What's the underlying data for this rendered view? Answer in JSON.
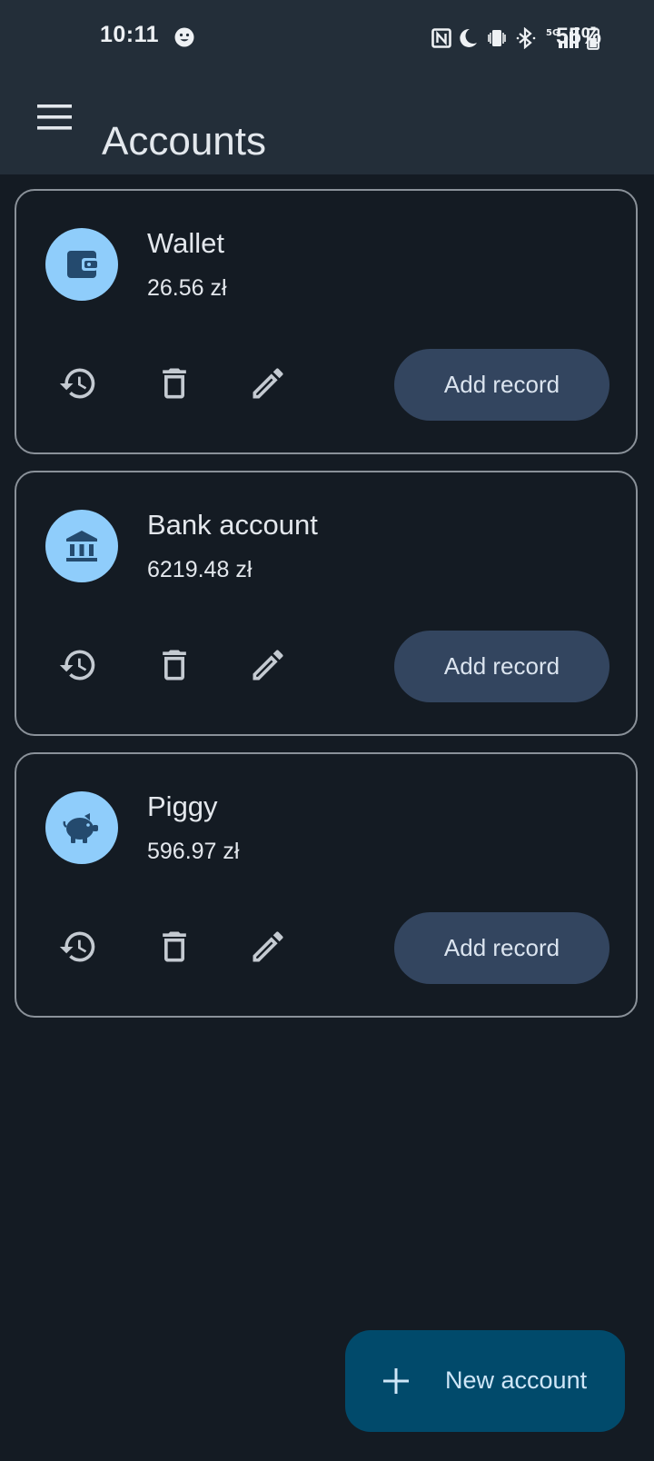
{
  "status_bar": {
    "time": "10:11",
    "battery": "55%",
    "icons": [
      "emoji-face-icon",
      "nfc-icon",
      "moon-icon",
      "vibrate-icon",
      "bluetooth-icon",
      "5g-signal-icon",
      "battery-icon"
    ]
  },
  "header": {
    "title": "Accounts",
    "menu_icon": "hamburger-menu-icon"
  },
  "accounts": [
    {
      "name": "Wallet",
      "balance": "26.56 zł",
      "icon": "wallet-icon",
      "add_record_label": "Add record"
    },
    {
      "name": "Bank account",
      "balance": "6219.48 zł",
      "icon": "bank-icon",
      "add_record_label": "Add record"
    },
    {
      "name": "Piggy",
      "balance": "596.97 zł",
      "icon": "piggy-bank-icon",
      "add_record_label": "Add record"
    }
  ],
  "card_actions": [
    "history-icon",
    "delete-icon",
    "edit-icon"
  ],
  "fab": {
    "label": "New account",
    "icon": "plus-icon"
  },
  "colors": {
    "background": "#141b23",
    "app_bar": "#232e39",
    "avatar": "#8fcdfb",
    "avatar_glyph": "#244a6e",
    "button": "#33455f",
    "fab": "#014a6b",
    "card_border": "#8a9199",
    "action_icon": "#c4cad1"
  }
}
